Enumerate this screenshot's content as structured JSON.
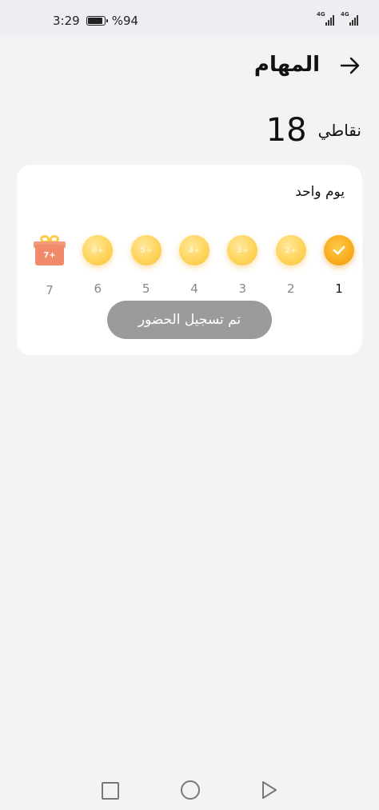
{
  "status_bar": {
    "time": "3:29",
    "battery": "%94",
    "network_1": "4G",
    "network_2": "4G"
  },
  "header": {
    "title": "المهام",
    "back_icon": "arrow-right-icon"
  },
  "points": {
    "label": "نقاطي",
    "value": "18"
  },
  "checkin_card": {
    "title": "يوم واحد",
    "days": [
      {
        "day": "1",
        "reward": "",
        "state": "checked"
      },
      {
        "day": "2",
        "reward": "2+",
        "state": "pending"
      },
      {
        "day": "3",
        "reward": "3+",
        "state": "pending"
      },
      {
        "day": "4",
        "reward": "4+",
        "state": "pending"
      },
      {
        "day": "5",
        "reward": "5+",
        "state": "pending"
      },
      {
        "day": "6",
        "reward": "6+",
        "state": "pending"
      },
      {
        "day": "7",
        "reward": "7+",
        "state": "gift"
      }
    ],
    "button_label": "تم تسجيل الحضور"
  },
  "colors": {
    "background": "#f2f3f5",
    "card": "#ffffff",
    "coin": "#ffd45c",
    "coin_checked": "#f8ab1c",
    "gift": "#f08a6a",
    "button": "#9b9b9b"
  },
  "nav_bar": {
    "icons": [
      "recent-apps-icon",
      "home-icon",
      "back-icon"
    ]
  }
}
